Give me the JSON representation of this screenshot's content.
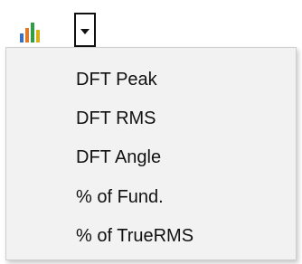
{
  "toolbar": {
    "chart_button_icon": "bar-chart-icon",
    "dropdown_arrow_icon": "chevron-down-icon"
  },
  "menu": {
    "items": [
      {
        "label": "DFT Peak"
      },
      {
        "label": "DFT RMS"
      },
      {
        "label": "DFT Angle"
      },
      {
        "label": "% of Fund."
      },
      {
        "label": "% of TrueRMS"
      }
    ]
  },
  "colors": {
    "bar_colors": [
      "#3a6fc4",
      "#e07a2a",
      "#2f9e44",
      "#d6b21a"
    ],
    "menu_background": "#f2f2f2",
    "menu_border": "#cfcfcf",
    "text": "#111111"
  }
}
